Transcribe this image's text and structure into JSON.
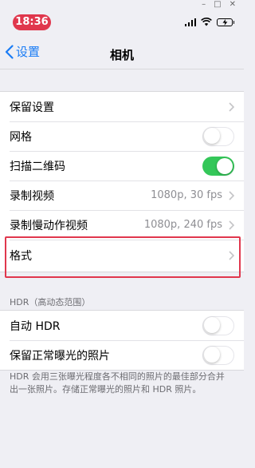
{
  "status_bar": {
    "time": "18:36"
  },
  "nav": {
    "back_label": "设置",
    "title": "相机"
  },
  "group1": [
    {
      "label": "保留设置",
      "control": "chevron"
    },
    {
      "label": "网格",
      "control": "toggle",
      "on": false
    },
    {
      "label": "扫描二维码",
      "control": "toggle",
      "on": true
    },
    {
      "label": "录制视频",
      "value": "1080p, 30 fps",
      "control": "chevron"
    },
    {
      "label": "录制慢动作视频",
      "value": "1080p, 240 fps",
      "control": "chevron"
    },
    {
      "label": "格式",
      "control": "chevron"
    }
  ],
  "hdr_section": {
    "header": "HDR（高动态范围）",
    "rows": [
      {
        "label": "自动 HDR",
        "control": "toggle",
        "on": false
      },
      {
        "label": "保留正常曝光的照片",
        "control": "toggle",
        "on": false
      }
    ],
    "footer": "HDR 会用三张曝光程度各不相同的照片的最佳部分合并出一张照片。存储正常曝光的照片和 HDR 照片。"
  },
  "colors": {
    "accent": "#1a7cf5",
    "toggle_on": "#34c759",
    "highlight": "#e0374d",
    "time_pill": "#e0374d"
  },
  "icons": [
    "back-chevron-icon",
    "chevron-right-icon",
    "signal-icon",
    "wifi-icon",
    "battery-charging-icon"
  ]
}
